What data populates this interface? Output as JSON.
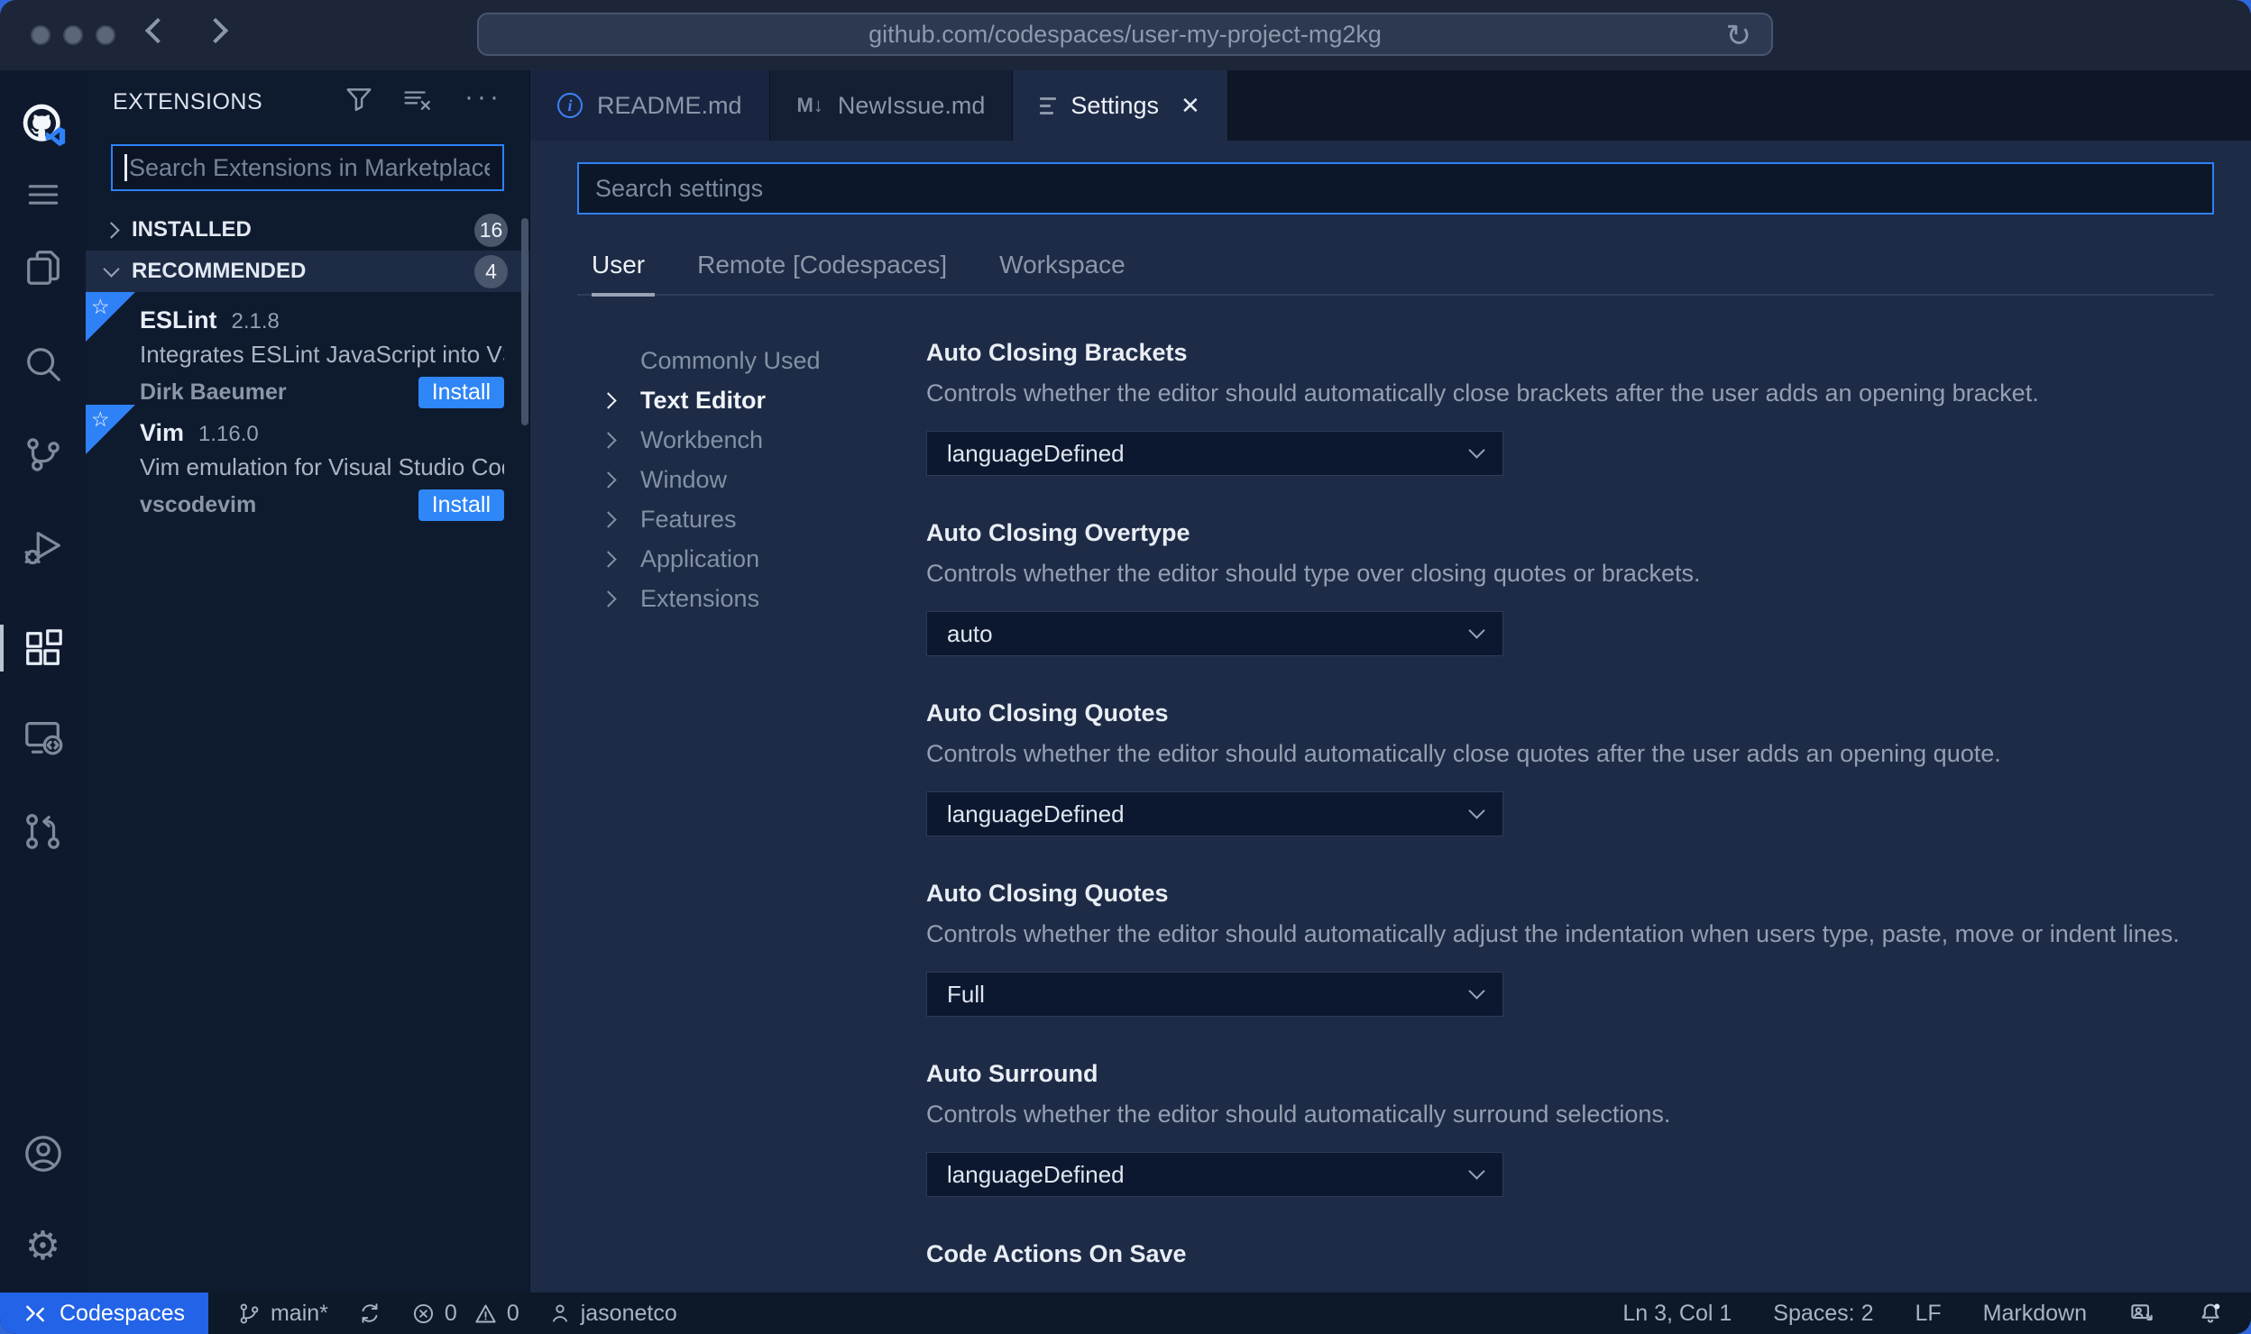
{
  "browser": {
    "url": "github.com/codespaces/user-my-project-mg2kg"
  },
  "sidebar": {
    "title": "EXTENSIONS",
    "search_placeholder": "Search Extensions in Marketplace",
    "sections": [
      {
        "label": "INSTALLED",
        "count": "16",
        "state": "collapsed"
      },
      {
        "label": "RECOMMENDED",
        "count": "4",
        "state": "expanded"
      }
    ],
    "extensions": [
      {
        "name": "ESLint",
        "version": "2.1.8",
        "description": "Integrates ESLint JavaScript into VS C...",
        "author": "Dirk Baeumer",
        "action_label": "Install"
      },
      {
        "name": "Vim",
        "version": "1.16.0",
        "description": "Vim emulation for Visual Studio Code...",
        "author": "vscodevim",
        "action_label": "Install"
      }
    ]
  },
  "editor": {
    "tabs": [
      {
        "label": "README.md",
        "icon": "info-icon",
        "active": false
      },
      {
        "label": "NewIssue.md",
        "icon": "markdown-icon",
        "active": false
      },
      {
        "label": "Settings",
        "icon": "settings-list-icon",
        "active": true
      }
    ],
    "settings": {
      "search_placeholder": "Search settings",
      "scopes": [
        {
          "label": "User",
          "active": true
        },
        {
          "label": "Remote [Codespaces]",
          "active": false
        },
        {
          "label": "Workspace",
          "active": false
        }
      ],
      "toc": [
        "Commonly Used",
        "Text Editor",
        "Workbench",
        "Window",
        "Features",
        "Application",
        "Extensions"
      ],
      "toc_selected": "Text Editor",
      "entries": [
        {
          "title": "Auto Closing Brackets",
          "description": "Controls whether the editor should automatically close brackets after the user adds an opening bracket.",
          "value": "languageDefined"
        },
        {
          "title": "Auto Closing Overtype",
          "description": "Controls whether the editor should type over closing quotes or brackets.",
          "value": "auto"
        },
        {
          "title": "Auto Closing Quotes",
          "description": "Controls whether the editor should automatically close quotes after the user adds an opening quote.",
          "value": "languageDefined"
        },
        {
          "title": "Auto Closing Quotes",
          "description": "Controls whether the editor should automatically adjust the indentation when users type, paste, move or indent lines.",
          "value": "Full"
        },
        {
          "title": "Auto Surround",
          "description": "Controls whether the editor should automatically surround selections.",
          "value": "languageDefined"
        },
        {
          "title": "Code Actions On Save",
          "description": "",
          "value": ""
        }
      ]
    }
  },
  "status_bar": {
    "remote_label": "Codespaces",
    "branch": "main*",
    "error_count": "0",
    "warning_count": "0",
    "user": "jasonetco",
    "cursor": "Ln 3, Col 1",
    "indent": "Spaces: 2",
    "eol": "LF",
    "language": "Markdown"
  },
  "colors": {
    "accent": "#2f81f7",
    "install_button": "#2f86f6",
    "codespaces_segment": "#2263e7",
    "window_backdrop": "#3068d9"
  }
}
